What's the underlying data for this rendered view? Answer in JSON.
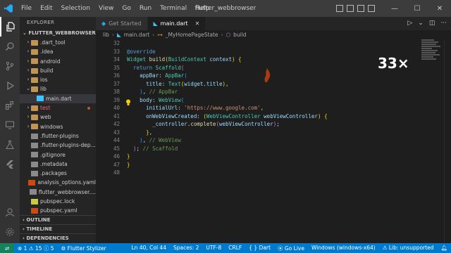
{
  "menu": [
    "File",
    "Edit",
    "Selection",
    "View",
    "Go",
    "Run",
    "Terminal",
    "Help"
  ],
  "window_title": "flutter_webbrowser",
  "explorer": {
    "header": "EXPLORER",
    "project": "FLUTTER_WEBBROWSER",
    "items": [
      {
        "label": ".dart_tool",
        "indent": 1,
        "chevron": "›",
        "color": "#cccccc"
      },
      {
        "label": ".idea",
        "indent": 1,
        "chevron": "›",
        "color": "#cccccc"
      },
      {
        "label": "android",
        "indent": 1,
        "chevron": "›",
        "color": "#cccccc"
      },
      {
        "label": "build",
        "indent": 1,
        "chevron": "›",
        "color": "#cccccc"
      },
      {
        "label": "ios",
        "indent": 1,
        "chevron": "›",
        "color": "#cccccc"
      },
      {
        "label": "lib",
        "indent": 1,
        "chevron": "⌄",
        "color": "#cccccc"
      },
      {
        "label": "main.dart",
        "indent": 2,
        "chevron": "",
        "color": "#cccccc"
      },
      {
        "label": "test",
        "indent": 1,
        "chevron": "›",
        "color": "#e06c75"
      },
      {
        "label": "web",
        "indent": 1,
        "chevron": "›",
        "color": "#cccccc"
      },
      {
        "label": "windows",
        "indent": 1,
        "chevron": "›",
        "color": "#cccccc"
      },
      {
        "label": ".flutter-plugins",
        "indent": 1,
        "chevron": "",
        "color": "#cccccc"
      },
      {
        "label": ".flutter-plugins-dep...",
        "indent": 1,
        "chevron": "",
        "color": "#cccccc"
      },
      {
        "label": ".gitignore",
        "indent": 1,
        "chevron": "",
        "color": "#cccccc"
      },
      {
        "label": ".metadata",
        "indent": 1,
        "chevron": "",
        "color": "#cccccc"
      },
      {
        "label": ".packages",
        "indent": 1,
        "chevron": "",
        "color": "#cccccc"
      },
      {
        "label": "analysis_options.yaml",
        "indent": 1,
        "chevron": "",
        "color": "#cccccc"
      },
      {
        "label": "flutter_webbrowser....",
        "indent": 1,
        "chevron": "",
        "color": "#cccccc"
      },
      {
        "label": "pubspec.lock",
        "indent": 1,
        "chevron": "",
        "color": "#cccccc"
      },
      {
        "label": "pubspec.yaml",
        "indent": 1,
        "chevron": "",
        "color": "#cccccc"
      }
    ],
    "sections": [
      "OUTLINE",
      "TIMELINE",
      "DEPENDENCIES"
    ]
  },
  "tabs": [
    {
      "label": "Get Started",
      "active": false
    },
    {
      "label": "main.dart",
      "active": true
    }
  ],
  "breadcrumb": [
    "lib",
    "main.dart",
    "_MyHomePageState",
    "build"
  ],
  "line_numbers": [
    "32",
    "33",
    "34",
    "35",
    "36",
    "37",
    "38",
    "39",
    "40",
    "41",
    "42",
    "43",
    "44",
    "45",
    "46",
    "47",
    "48"
  ],
  "overlay_text": "33×",
  "statusbar": {
    "errors": "1",
    "warnings": "15",
    "info": "5",
    "flutter": "Flutter Stylizer",
    "position": "Ln 40, Col 44",
    "spaces": "Spaces: 2",
    "encoding": "UTF-8",
    "eol": "CRLF",
    "language": "Dart",
    "golive": "Go Live",
    "device": "Windows (windows-x64)",
    "lsp": "Lib: unsupported"
  },
  "colors": {
    "activity_bar": "#333333",
    "sidebar": "#252526",
    "editor": "#1e1e1e",
    "statusbar": "#007acc"
  }
}
